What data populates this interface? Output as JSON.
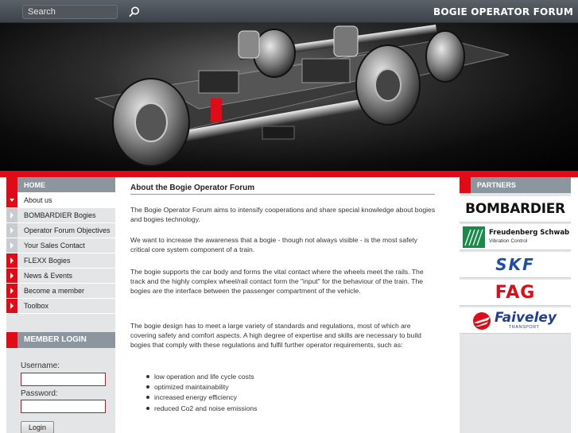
{
  "header": {
    "search_placeholder": "Search",
    "site_title": "BOGIE OPERATOR FORUM"
  },
  "sidebar": {
    "home_label": "HOME",
    "items": [
      {
        "label": "About us",
        "marker": "chevron-down-icon",
        "active": true
      },
      {
        "label": "BOMBARDIER Bogies",
        "marker": "chevron-right-icon"
      },
      {
        "label": "Operator Forum Objectives",
        "marker": "chevron-right-icon"
      },
      {
        "label": "Your Sales Contact",
        "marker": "chevron-right-icon"
      },
      {
        "label": "FLEXX Bogies",
        "marker": "chevron-right-icon"
      },
      {
        "label": "News & Events",
        "marker": "chevron-right-icon"
      },
      {
        "label": "Become a member",
        "marker": "chevron-right-icon"
      },
      {
        "label": "Toolbox",
        "marker": "chevron-right-icon"
      }
    ]
  },
  "login": {
    "title": "MEMBER LOGIN",
    "username_label": "Username:",
    "password_label": "Password:",
    "button_label": "Login"
  },
  "main": {
    "title": "About the Bogie Operator Forum",
    "paragraphs": [
      "The Bogie Operator Forum aims to intensify cooperations and share special knowledge about bogies and bogies technology.",
      "We want to increase the awareness that a bogie - though not always visible - is the most safety critical core system component of a train.",
      "The bogie supports the car body and forms the vital contact where the wheels meet the rails. The track and the highly complex wheel/rail contact form the \"input\" for the behaviour of the train. The bogies are the interface between the passenger compartment of the vehicle.",
      "The bogie design has to meet a large variety of standards and regulations, most of which are covering safety and comfort aspects. A high degree of expertise and skills are necessary to build bogies that comply with these regulations and fulfil further operator requirements, such as:"
    ],
    "bullets": [
      "low operation and life cycle costs",
      "optimized maintainability",
      "increased energy efficiency",
      "reduced Co2 and noise emissions"
    ]
  },
  "partners": {
    "title": "PARTNERS",
    "bombardier": "BOMBARDIER",
    "freudenberg_name": "Freudenberg Schwab",
    "freudenberg_sub": "Vibration Control",
    "skf": "SKF",
    "fag": "FAG",
    "faiveley_name": "Faiveley",
    "faiveley_sub": "TRANSPORT"
  },
  "colors": {
    "accent_red": "#e10a17",
    "nav_grey": "#8c969f",
    "panel_grey": "#e3e5e7"
  }
}
